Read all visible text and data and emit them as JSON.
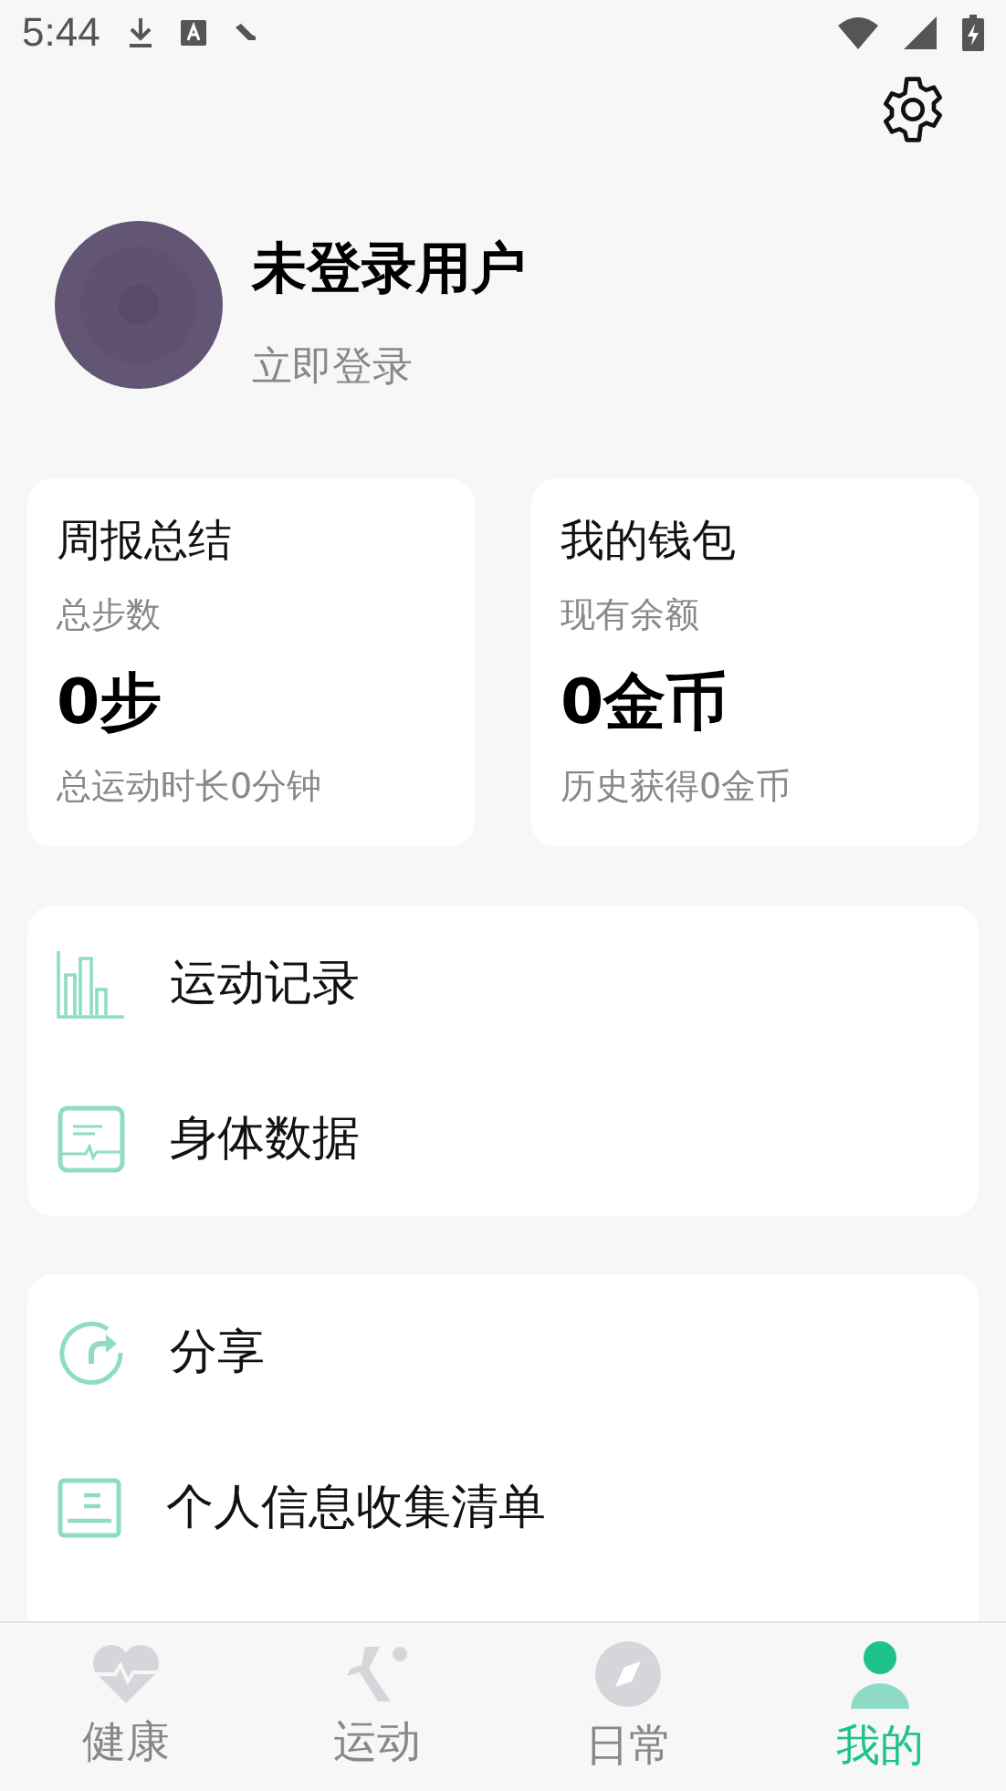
{
  "status_bar": {
    "time": "5:44"
  },
  "profile": {
    "name": "未登录用户",
    "login_link": "立即登录"
  },
  "summary_cards": [
    {
      "title": "周报总结",
      "subtitle": "总步数",
      "value": "0步",
      "footer": "总运动时长0分钟"
    },
    {
      "title": "我的钱包",
      "subtitle": "现有余额",
      "value": "0金币",
      "footer": "历史获得0金币"
    }
  ],
  "menu_groups": [
    [
      {
        "kind": "chart",
        "label": "运动记录"
      },
      {
        "kind": "monitor",
        "label": "身体数据"
      }
    ],
    [
      {
        "kind": "share",
        "label": "分享"
      },
      {
        "kind": "list",
        "label": "个人信息收集清单"
      }
    ]
  ],
  "bottom_nav": [
    {
      "kind": "health",
      "label": "健康",
      "selected": false
    },
    {
      "kind": "sport",
      "label": "运动",
      "selected": false
    },
    {
      "kind": "daily",
      "label": "日常",
      "selected": false
    },
    {
      "kind": "me",
      "label": "我的",
      "selected": true
    }
  ]
}
